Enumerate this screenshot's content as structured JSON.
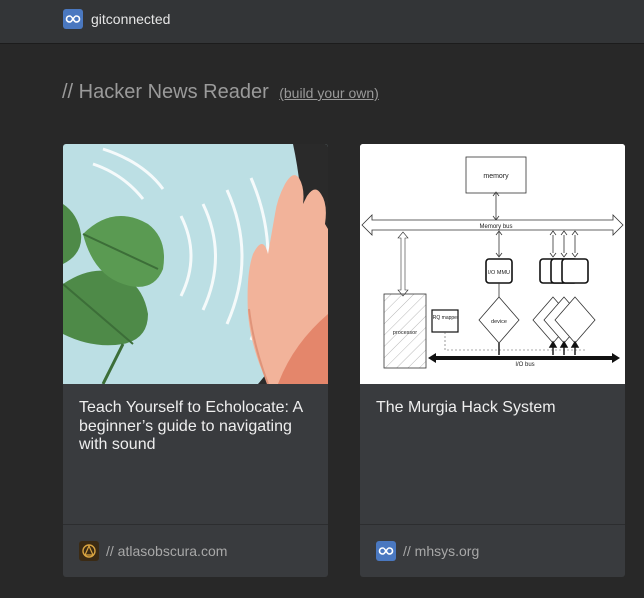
{
  "header": {
    "brand": "gitconnected",
    "logo_icon": "infinity-icon",
    "accent": "#4a78c0"
  },
  "heading": {
    "title": "// Hacker News Reader",
    "link": "(build your own)"
  },
  "cards": [
    {
      "title": "Teach Yourself to Echolocate: A beginner’s guide to navigating with sound",
      "source": "// atlasobscura.com",
      "source_icon": "atlas-obscura-icon"
    },
    {
      "title": "The Murgia Hack System",
      "source": "// mhsys.org",
      "source_icon": "infinity-icon",
      "diagram": {
        "memory": "memory",
        "memory_bus": "Memory bus",
        "io_mmu": "I/O MMU",
        "irq_mapper": "IRQ mapper",
        "processor": "processor",
        "device": "device",
        "io_bus": "I/O bus"
      }
    }
  ]
}
